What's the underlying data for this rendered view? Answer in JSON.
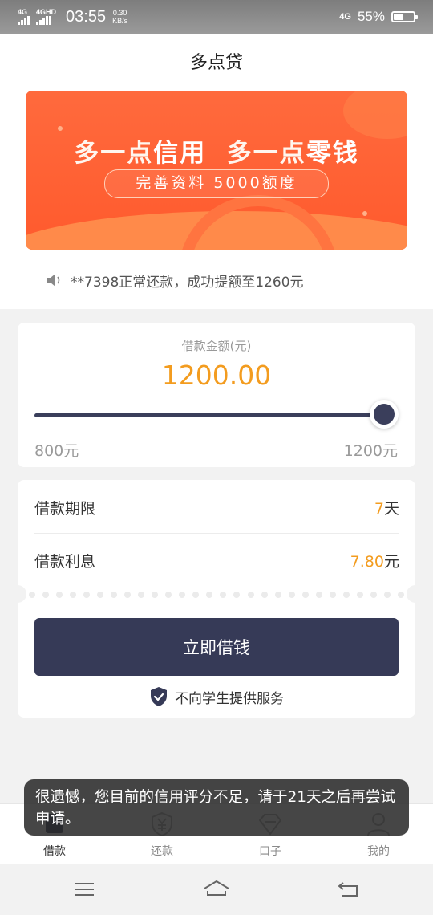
{
  "status_bar": {
    "sim1": "4G",
    "sim2": "4GHD",
    "time": "03:55",
    "speed_value": "0.30",
    "speed_unit": "KB/s",
    "network": "4G",
    "battery": "55%",
    "battery_level": 0.55
  },
  "header": {
    "title": "多点贷"
  },
  "banner": {
    "headline_part1": "多一点",
    "headline_part2": "信用",
    "headline_part3": "多一点",
    "headline_part4": "零钱",
    "sub": "完善资料 5000额度"
  },
  "notice": {
    "text": "**7398正常还款，成功提额至1260元"
  },
  "loan": {
    "amount_label": "借款金额(元)",
    "amount": "1200.00",
    "min_label": "800元",
    "max_label": "1200元",
    "slider_fraction": 1.0
  },
  "terms": {
    "period_label": "借款期限",
    "period_value": "7",
    "period_unit": "天",
    "interest_label": "借款利息",
    "interest_value": "7.80",
    "interest_unit": "元"
  },
  "actions": {
    "borrow_button": "立即借钱",
    "student_notice": "不向学生提供服务"
  },
  "toast": {
    "message": "很遗憾，您目前的信用评分不足，请于21天之后再尝试申请。"
  },
  "tabs": [
    {
      "label": "借款",
      "icon": "home-icon"
    },
    {
      "label": "还款",
      "icon": "yen-shield-icon"
    },
    {
      "label": "口子",
      "icon": "diamond-icon"
    },
    {
      "label": "我的",
      "icon": "person-icon"
    }
  ],
  "colors": {
    "accent": "#f39c1f",
    "primary": "#363a57",
    "banner": "#ff5a2d"
  }
}
